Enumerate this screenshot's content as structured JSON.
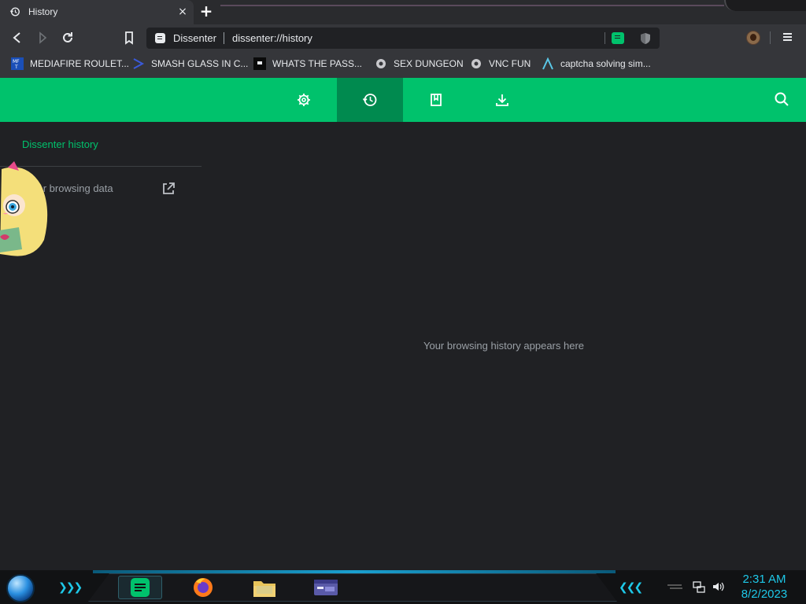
{
  "tab": {
    "title": "History",
    "close_glyph": "×",
    "new_tab_glyph": "+"
  },
  "toolbar": {
    "site_name": "Dissenter",
    "url": "dissenter://history",
    "icons": [
      "back-icon",
      "forward-icon",
      "reload-icon",
      "bookmark-icon",
      "menu-icon"
    ]
  },
  "bookmarks": [
    {
      "label": "MEDIAFIRE ROULET...",
      "icon": "mediafire-icon"
    },
    {
      "label": "SMASH GLASS IN C...",
      "icon": "chevron-favicon"
    },
    {
      "label": "WHATS THE PASS...",
      "icon": "dark-favicon"
    },
    {
      "label": "SEX DUNGEON",
      "icon": "gear-favicon"
    },
    {
      "label": "VNC FUN",
      "icon": "gear-favicon"
    },
    {
      "label": "captcha solving sim...",
      "icon": "lambda-favicon"
    }
  ],
  "app_nav": {
    "items": [
      "settings-icon",
      "history-icon",
      "bookmarks-icon",
      "downloads-icon"
    ],
    "active": "history-icon",
    "search": "search-icon"
  },
  "sidebar": {
    "title": "Dissenter history",
    "clear_label": "Clear browsing data"
  },
  "main": {
    "empty_message": "Your browsing history appears here"
  },
  "taskbar": {
    "time": "2:31 AM",
    "date": "8/2/2023"
  },
  "colors": {
    "accent": "#00c26c",
    "accent_dark": "#008a4f",
    "background": "#202124",
    "chrome": "#35363a",
    "clock": "#1ec8e8"
  }
}
